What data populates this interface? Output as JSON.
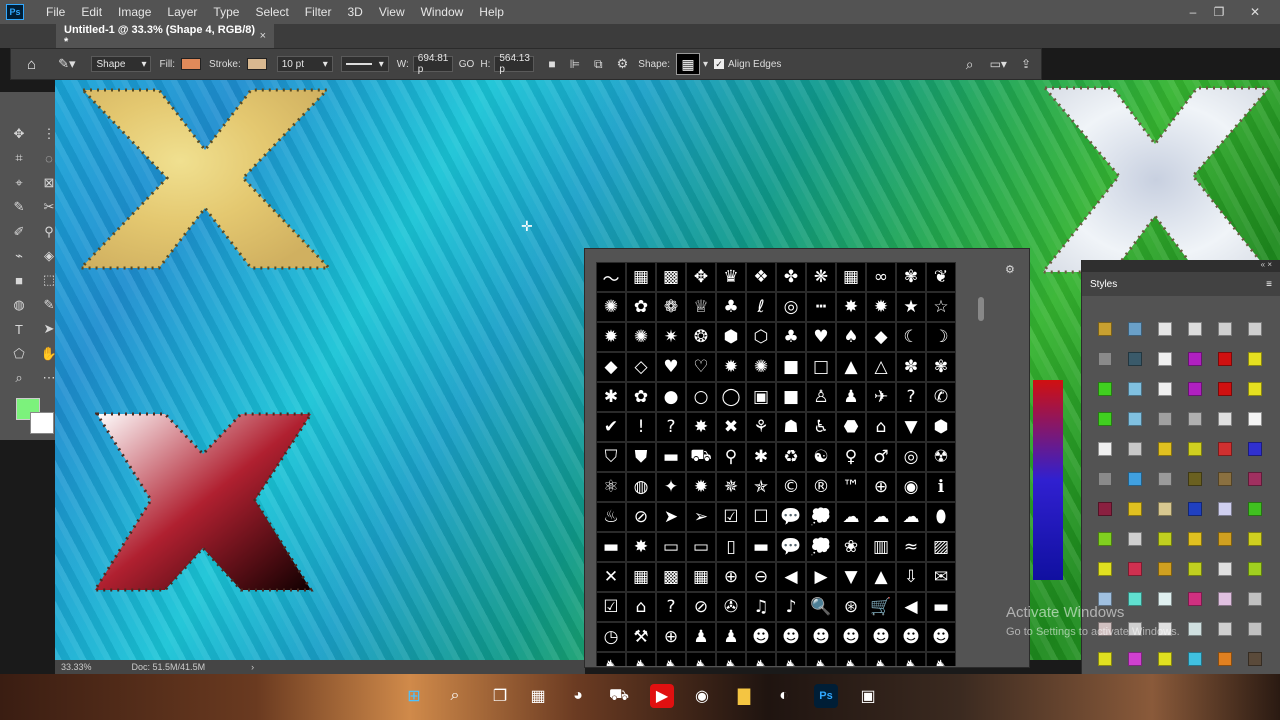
{
  "app": {
    "logo": "Ps"
  },
  "menu": [
    "File",
    "Edit",
    "Image",
    "Layer",
    "Type",
    "Select",
    "Filter",
    "3D",
    "View",
    "Window",
    "Help"
  ],
  "window_controls": {
    "min": "–",
    "max": "❐",
    "close": "✕"
  },
  "doc_tab": {
    "title": "Untitled-1 @ 33.3% (Shape 4, RGB/8) *",
    "close": "×"
  },
  "options": {
    "mode": "Shape",
    "fill_label": "Fill:",
    "stroke_label": "Stroke:",
    "stroke_size": "10 pt",
    "w_label": "W:",
    "w_value": "694.81 p",
    "link": "GO",
    "h_label": "H:",
    "h_value": "564.13 p",
    "shape_label": "Shape:",
    "align_edges": "Align Edges",
    "fill_color": "#e08a5a",
    "stroke_color": "#d8b890"
  },
  "status": {
    "zoom": "33.33%",
    "doc": "Doc: 51.5M/41.5M"
  },
  "shapes": [
    "〜",
    "▦",
    "▩",
    "✥",
    "♛",
    "❖",
    "✤",
    "❋",
    "▦",
    "∞",
    "✾",
    "❦",
    "✺",
    "✿",
    "❁",
    "♕",
    "♣",
    "ℓ",
    "◎",
    "┅",
    "✸",
    "✹",
    "★",
    "☆",
    "✹",
    "✺",
    "✷",
    "❂",
    "⬢",
    "⬡",
    "♣",
    "♥",
    "♠",
    "◆",
    "☾",
    "☽",
    "◆",
    "◇",
    "♥",
    "♡",
    "✹",
    "✺",
    "■",
    "□",
    "▲",
    "△",
    "✽",
    "✾",
    "✱",
    "✿",
    "●",
    "○",
    "◯",
    "▣",
    "■",
    "♙",
    "♟",
    "✈",
    "?",
    "✆",
    "✔",
    "!",
    "?",
    "✸",
    "✖",
    "⚘",
    "☗",
    "♿",
    "⬣",
    "⌂",
    "▼",
    "⬢",
    "⛉",
    "⛊",
    "▬",
    "⛟",
    "⚲",
    "✱",
    "♻",
    "☯",
    "♀",
    "♂",
    "◎",
    "☢",
    "⚛",
    "◍",
    "✦",
    "✹",
    "✵",
    "✯",
    "©",
    "®",
    "™",
    "⊕",
    "◉",
    "ℹ",
    "♨",
    "⊘",
    "➤",
    "➢",
    "☑",
    "☐",
    "💬",
    "💭",
    "☁",
    "☁",
    "☁",
    "⬮",
    "▬",
    "✸",
    "▭",
    "▭",
    "▯",
    "▬",
    "💬",
    "💭",
    "❀",
    "▥",
    "≈",
    "▨",
    "✕",
    "▦",
    "▩",
    "▦",
    "⊕",
    "⊖",
    "◀",
    "▶",
    "▼",
    "▲",
    "⇩",
    "✉",
    "☑",
    "⌂",
    "?",
    "⊘",
    "✇",
    "♫",
    "♪",
    "🔍",
    "⊛",
    "🛒",
    "◀",
    "▬",
    "◷",
    "⚒",
    "⊕",
    "♟",
    "♟",
    "☻",
    "☻",
    "☻",
    "☻",
    "☻",
    "☻",
    "☻",
    "♞",
    "♞",
    "♞",
    "♞",
    "♞",
    "♞",
    "♞",
    "♞",
    "♞",
    "♞",
    "♞",
    "♞"
  ],
  "styles_panel": {
    "title": "Styles",
    "menu": "≡"
  },
  "style_swatches": [
    "#c8a030",
    "#6aa0c8",
    "#e6e6e6",
    "#dcdcdc",
    "#d0d0d0",
    "#cfcfcf",
    "#8a8a8a",
    "#3a5a6a",
    "#f0f0f0",
    "#b020c0",
    "#d01010",
    "#e6e020",
    "#40d020",
    "#80c0e0",
    "#f0f0f0",
    "#b020c0",
    "#d01010",
    "#e6e020",
    "#40d020",
    "#80c0e0",
    "#a0a0a0",
    "#b0b0b0",
    "#e0e0e0",
    "#f4f4f4",
    "#f0f0f0",
    "#c8c8c8",
    "#e0c020",
    "#d0d020",
    "#d03030",
    "#3030d0",
    "#8a8a8a",
    "#40a0e0",
    "#9a9a9a",
    "#6a6020",
    "#8a7040",
    "#a03060",
    "#8a2040",
    "#e0c020",
    "#d8c890",
    "#2040c0",
    "#d0d0f0",
    "#40c020",
    "#80d020",
    "#d0d0d0",
    "#c0d020",
    "#e0c020",
    "#d0a020",
    "#d0d020",
    "#e0e020",
    "#d03050",
    "#d0a020",
    "#c0d020",
    "#e0e0e0",
    "#a0d020",
    "#a0c0e0",
    "#60e0d0",
    "#e0f0f0",
    "#d03080",
    "#e0c0e0",
    "#c0c0c0",
    "#d0c0c0",
    "#d0d0d0",
    "#e0e0e0",
    "#d0e0e0",
    "#d0d0d0",
    "#c0c0c0",
    "#e0e020",
    "#d040d0",
    "#e0e020",
    "#40c0e0",
    "#e08020",
    "#5a4a3a",
    "#d03030",
    "#a0a0a0",
    "#d03030",
    "#d06020",
    "#d07020",
    "#d05020"
  ],
  "watermark": {
    "line1": "Activate Windows",
    "line2": "Go to Settings to activate Windows."
  },
  "taskbar": [
    "windows-icon",
    "search-icon",
    "task-view-icon",
    "widgets-icon",
    "github-icon",
    "store-icon",
    "youtube-icon",
    "chrome-icon",
    "file-explorer-icon",
    "edge-icon",
    "photoshop-icon",
    "app-icon"
  ],
  "taskbar_glyphs": [
    "⊞",
    "⌕",
    "❐",
    "▦",
    "◕",
    "⛟",
    "▶",
    "◉",
    "▇",
    "◐",
    "Ps",
    "▣"
  ],
  "left_tools": [
    "✥",
    "⋮",
    "⌗",
    "◌",
    "⌖",
    "⊠",
    "✎",
    "✂",
    "✐",
    "⚲",
    "⌁",
    "◈",
    "■",
    "⬚",
    "◍",
    "✎",
    "T",
    "➤",
    "⬠",
    "✋",
    "⌕",
    "⋯"
  ]
}
